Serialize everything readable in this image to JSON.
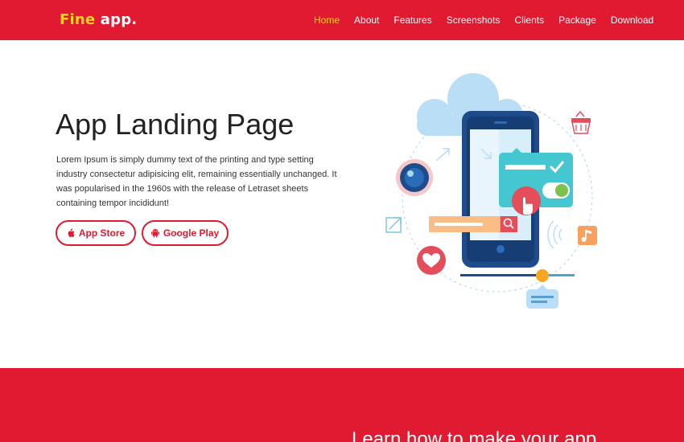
{
  "brand": {
    "logo_part1": "Fine",
    "logo_part2": "app.",
    "primary_color": "#e01a30",
    "accent_color": "#ffd21e"
  },
  "nav": {
    "items": [
      {
        "label": "Home",
        "active": true
      },
      {
        "label": "About"
      },
      {
        "label": "Features"
      },
      {
        "label": "Screenshots"
      },
      {
        "label": "Clients"
      },
      {
        "label": "Package"
      },
      {
        "label": "Download"
      }
    ]
  },
  "hero": {
    "title": "App Landing Page",
    "description": "Lorem Ipsum is simply dummy text of the printing and type setting industry consectetur adipisicing elit, remaining essentially unchanged. It was popularised in the 1960s with the release of Letraset sheets containing tempor incididunt!",
    "buttons": {
      "app_store": {
        "label": "App Store",
        "icon": "apple-icon"
      },
      "google_play": {
        "label": "Google Play",
        "icon": "android-icon"
      }
    },
    "illustration": {
      "icons": [
        "cloud-icon",
        "smartphone-icon",
        "shopping-basket-icon",
        "camera-lens-icon",
        "toggle-card-icon",
        "hand-pointer-icon",
        "search-bar-icon",
        "heart-icon",
        "music-note-icon",
        "expand-arrow-icon",
        "chat-bubble-icon",
        "slider-icon"
      ]
    }
  },
  "section2": {
    "heading": "Learn how to make your app"
  }
}
